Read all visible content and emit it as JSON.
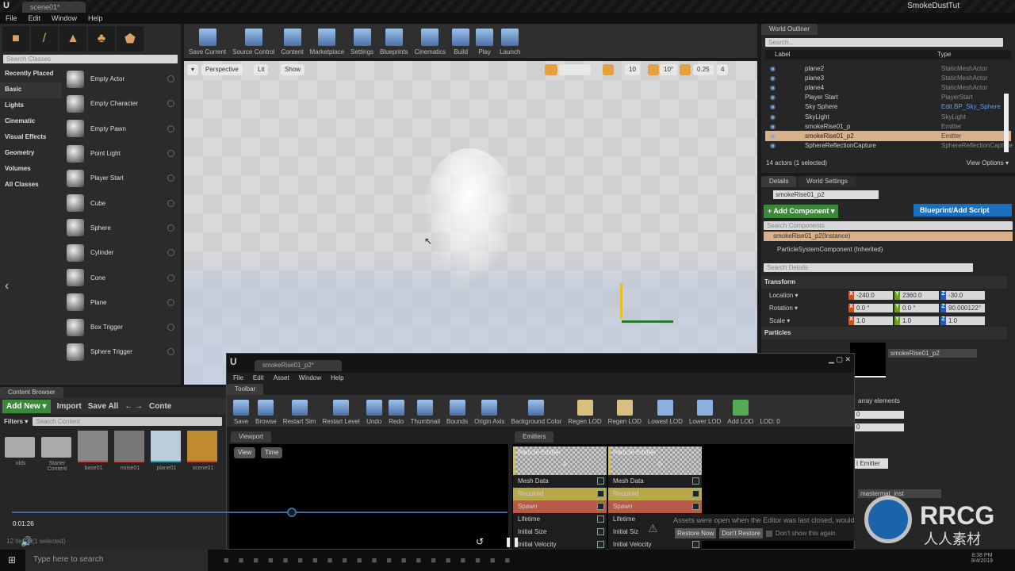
{
  "window": {
    "doc_tab": "scene01*",
    "project": "SmokeDustTut",
    "menu": [
      "File",
      "Edit",
      "Window",
      "Help"
    ]
  },
  "modes": {
    "search_placeholder": "Search Classes",
    "categories": [
      "Recently Placed",
      "Basic",
      "Lights",
      "Cinematic",
      "Visual Effects",
      "Geometry",
      "Volumes",
      "All Classes"
    ],
    "selected_category": "Basic",
    "items": [
      "Empty Actor",
      "Empty Character",
      "Empty Pawn",
      "Point Light",
      "Player Start",
      "Cube",
      "Sphere",
      "Cylinder",
      "Cone",
      "Plane",
      "Box Trigger",
      "Sphere Trigger"
    ]
  },
  "toolbar": [
    "Save Current",
    "Source Control",
    "Content",
    "Marketplace",
    "Settings",
    "Blueprints",
    "Cinematics",
    "Build",
    "Play",
    "Launch"
  ],
  "viewport": {
    "menu": "▾",
    "perspective": "Perspective",
    "lit": "Lit",
    "show": "Show",
    "grid": "10",
    "angle": "10°",
    "scale": "0.25",
    "camera_speed": "4"
  },
  "outliner": {
    "tab": "World Outliner",
    "search_placeholder": "Search...",
    "col_label": "Label",
    "col_type": "Type",
    "rows": [
      [
        "plane2",
        "StaticMeshActor"
      ],
      [
        "plane3",
        "StaticMeshActor"
      ],
      [
        "plane4",
        "StaticMeshActor"
      ],
      [
        "Player Start",
        "PlayerStart"
      ],
      [
        "Sky Sphere",
        "Edit BP_Sky_Sphere"
      ],
      [
        "SkyLight",
        "SkyLight"
      ],
      [
        "smokeRise01_p",
        "Emitter"
      ],
      [
        "smokeRise01_p2",
        "Emitter"
      ],
      [
        "SphereReflectionCapture",
        "SphereReflectionCapture"
      ]
    ],
    "selected": "smokeRise01_p2",
    "status": "14 actors (1 selected)",
    "view_options": "View Options ▾"
  },
  "details": {
    "tab": "Details",
    "tab2": "World Settings",
    "name": "smokeRise01_p2",
    "add_component": "+ Add Component ▾",
    "blueprint": "Blueprint/Add Script",
    "search_components": "Search Components",
    "instance": "smokeRise01_p2(Instance)",
    "component": "ParticleSystemComponent (Inherited)",
    "search_details": "Search Details",
    "transform": "Transform",
    "location_label": "Location ▾",
    "rotation_label": "Rotation ▾",
    "scale_label": "Scale ▾",
    "location": [
      "-240.0",
      "2360.0",
      "-30.0"
    ],
    "rotation": [
      "0.0 °",
      "0.0 °",
      "90.000122°"
    ],
    "scale": [
      "1.0",
      "1.0",
      "1.0"
    ],
    "particles": "Particles",
    "template": "smokeRise01_p2",
    "array_elements": "array elements",
    "emitter_btn": "t Emitter",
    "material": "mastermat_inst",
    "array_vals": [
      "0",
      "0"
    ]
  },
  "content_browser": {
    "tab": "Content Browser",
    "add_new": "Add New ▾",
    "import": "Import",
    "save_all": "Save All",
    "path": "Conte",
    "filters": "Filters ▾",
    "search_placeholder": "Search Content",
    "assets": [
      "olds",
      "Starter Content",
      "base01",
      "noise01",
      "plane01",
      "scene01"
    ],
    "status": "12 items (1 selected)"
  },
  "cascade": {
    "tab": "smokeRise01_p2*",
    "menu": [
      "File",
      "Edit",
      "Asset",
      "Window",
      "Help"
    ],
    "toolbar_tab": "Toolbar",
    "tools": [
      "Save",
      "Browse",
      "Restart Sim",
      "Restart Level",
      "Undo",
      "Redo",
      "Thumbnail",
      "Bounds",
      "Origin Axis",
      "Background Color",
      "Regen LOD",
      "Regen LOD",
      "Lowest LOD",
      "Lower LOD",
      "Add LOD"
    ],
    "lod_label": "LOD:",
    "lod_value": "0",
    "viewport_tab": "Viewport",
    "view": "View",
    "time": "Time",
    "emitters_tab": "Emitters",
    "emitters": [
      {
        "name": "Particle Emitter",
        "count": "4"
      },
      {
        "name": "Particle Emitter",
        "count": "0"
      }
    ],
    "modules": [
      "Mesh Data",
      "Required",
      "Spawn",
      "Lifetime",
      "Initial Size",
      "Initial Velocity"
    ]
  },
  "notification": {
    "text": "Assets were open when the Editor was last closed, would you like to restore them now?",
    "restore": "Restore Now",
    "dont": "Don't Restore",
    "dont_show": "Don't show this again"
  },
  "player": {
    "time": "0:01:26",
    "progress": 0.58
  },
  "taskbar": {
    "search": "Type here to search",
    "time": "8:38 PM",
    "date": "9/4/2019"
  },
  "watermark": {
    "text": "RRCG",
    "sub": "人人素材"
  }
}
